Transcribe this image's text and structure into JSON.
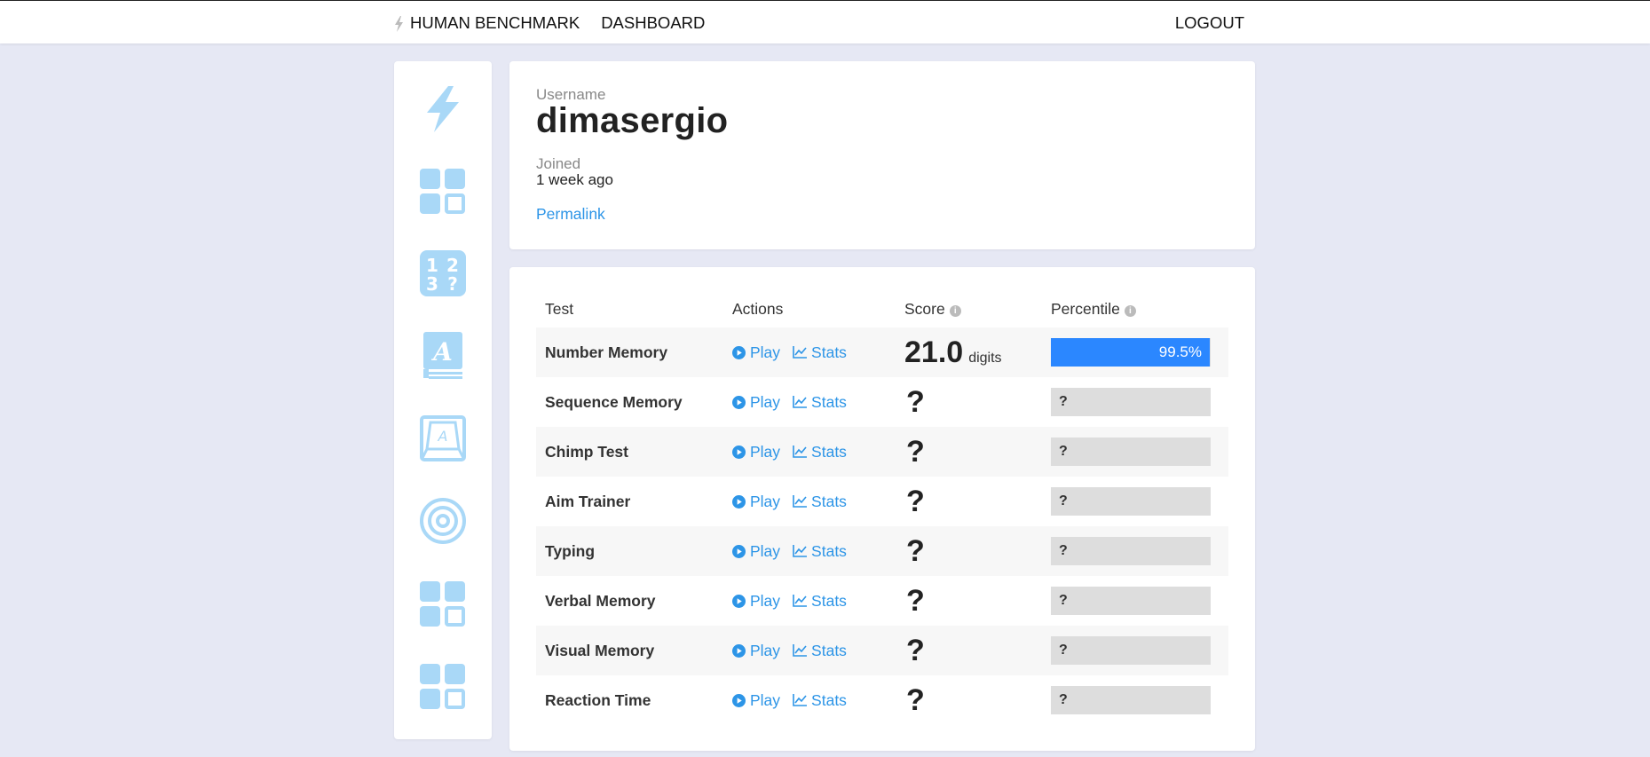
{
  "nav": {
    "brand": "HUMAN BENCHMARK",
    "dashboard": "DASHBOARD",
    "logout": "LOGOUT"
  },
  "sidebar": {
    "icons": [
      "bolt-icon",
      "grid-icon",
      "number-memory-icon",
      "verbal-memory-icon",
      "typing-icon",
      "aim-trainer-icon",
      "grid-icon",
      "grid-icon"
    ],
    "icon_color": "#a9d8f7"
  },
  "profile": {
    "username_label": "Username",
    "username": "dimasergio",
    "joined_label": "Joined",
    "joined_value": "1 week ago",
    "permalink": "Permalink"
  },
  "table": {
    "headers": {
      "test": "Test",
      "actions": "Actions",
      "score": "Score",
      "percentile": "Percentile"
    },
    "play_label": "Play",
    "stats_label": "Stats",
    "rows": [
      {
        "name": "Number Memory",
        "score": "21.0",
        "unit": "digits",
        "percentile": 0.995,
        "percentile_text": "99.5%"
      },
      {
        "name": "Sequence Memory",
        "score": "?",
        "percentile_text": "?"
      },
      {
        "name": "Chimp Test",
        "score": "?",
        "percentile_text": "?"
      },
      {
        "name": "Aim Trainer",
        "score": "?",
        "percentile_text": "?"
      },
      {
        "name": "Typing",
        "score": "?",
        "percentile_text": "?"
      },
      {
        "name": "Verbal Memory",
        "score": "?",
        "percentile_text": "?"
      },
      {
        "name": "Visual Memory",
        "score": "?",
        "percentile_text": "?"
      },
      {
        "name": "Reaction Time",
        "score": "?",
        "percentile_text": "?"
      }
    ]
  },
  "colors": {
    "accent": "#2d95e7",
    "bar": "#2b87ff",
    "background": "#e6e8f4"
  }
}
